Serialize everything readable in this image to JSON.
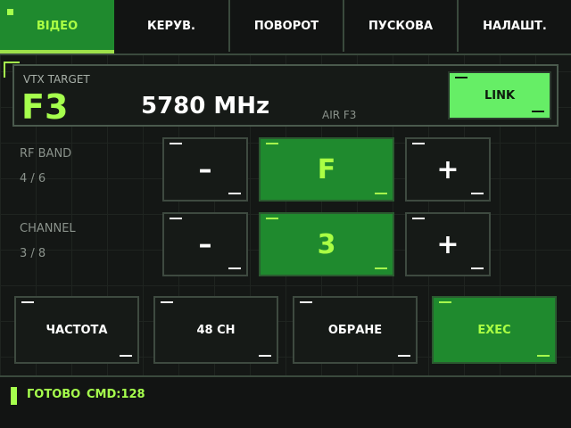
{
  "tabs": [
    {
      "label": "ВІДЕО",
      "active": true
    },
    {
      "label": "КЕРУВ.",
      "active": false
    },
    {
      "label": "ПОВОРОТ",
      "active": false
    },
    {
      "label": "ПУСКОВА",
      "active": false
    },
    {
      "label": "НАЛАШТ.",
      "active": false
    }
  ],
  "vtx": {
    "label": "VTX TARGET",
    "code": "F3",
    "frequency": "5780 MHz",
    "air_label": "AIR F3",
    "link_label": "LINK"
  },
  "rf_band": {
    "label": "RF BAND",
    "position": "4 / 6",
    "minus": "–",
    "value": "F",
    "plus": "+"
  },
  "channel": {
    "label": "CHANNEL",
    "position": "3 / 8",
    "minus": "–",
    "value": "3",
    "plus": "+"
  },
  "actions": {
    "freq": "ЧАСТОТА",
    "ch48": "48 CH",
    "favorite": "ОБРАНЕ",
    "exec": "EXEC"
  },
  "status": {
    "text": "ГОТОВО",
    "cmd": "CMD:128"
  },
  "colors": {
    "accent": "#a6ff4d",
    "active_green": "#1f8a2e",
    "link_green": "#66ee66",
    "background": "#141715"
  }
}
